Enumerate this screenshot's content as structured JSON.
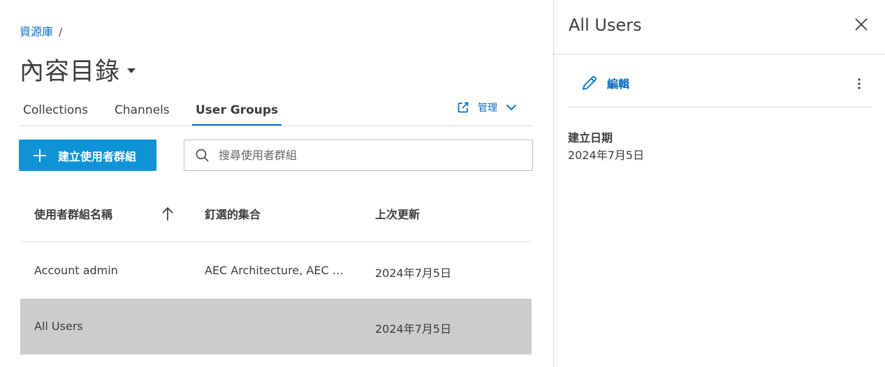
{
  "breadcrumb": {
    "root": "資源庫",
    "separator": "/"
  },
  "page": {
    "title": "內容目錄"
  },
  "tabs": [
    {
      "label": "Collections"
    },
    {
      "label": "Channels"
    },
    {
      "label": "User Groups",
      "active": true
    }
  ],
  "manage": {
    "label": "管理"
  },
  "toolbar": {
    "create_label": "建立使用者群組",
    "search_placeholder": "搜尋使用者群組"
  },
  "table": {
    "headers": [
      "使用者群組名稱",
      "釘選的集合",
      "上次更新"
    ],
    "sort": "ascending",
    "rows": [
      {
        "name": "Account admin",
        "collections": "AEC Architecture, AEC …",
        "updated": "2024年7月5日",
        "selected": false
      },
      {
        "name": "All Users",
        "collections": "",
        "updated": "2024年7月5日",
        "selected": true
      }
    ]
  },
  "panel": {
    "title": "All Users",
    "edit_label": "編輯",
    "created_label": "建立日期",
    "created_value": "2024年7月5日"
  },
  "colors": {
    "accent": "#0a6dc2",
    "button": "#0d93d6",
    "selected_row": "#cccccc"
  },
  "icons": [
    "caret-down-icon",
    "external-link-icon",
    "chevron-down-icon",
    "plus-icon",
    "search-icon",
    "sort-arrow-up-icon",
    "close-icon",
    "pencil-icon",
    "more-vertical-icon"
  ]
}
